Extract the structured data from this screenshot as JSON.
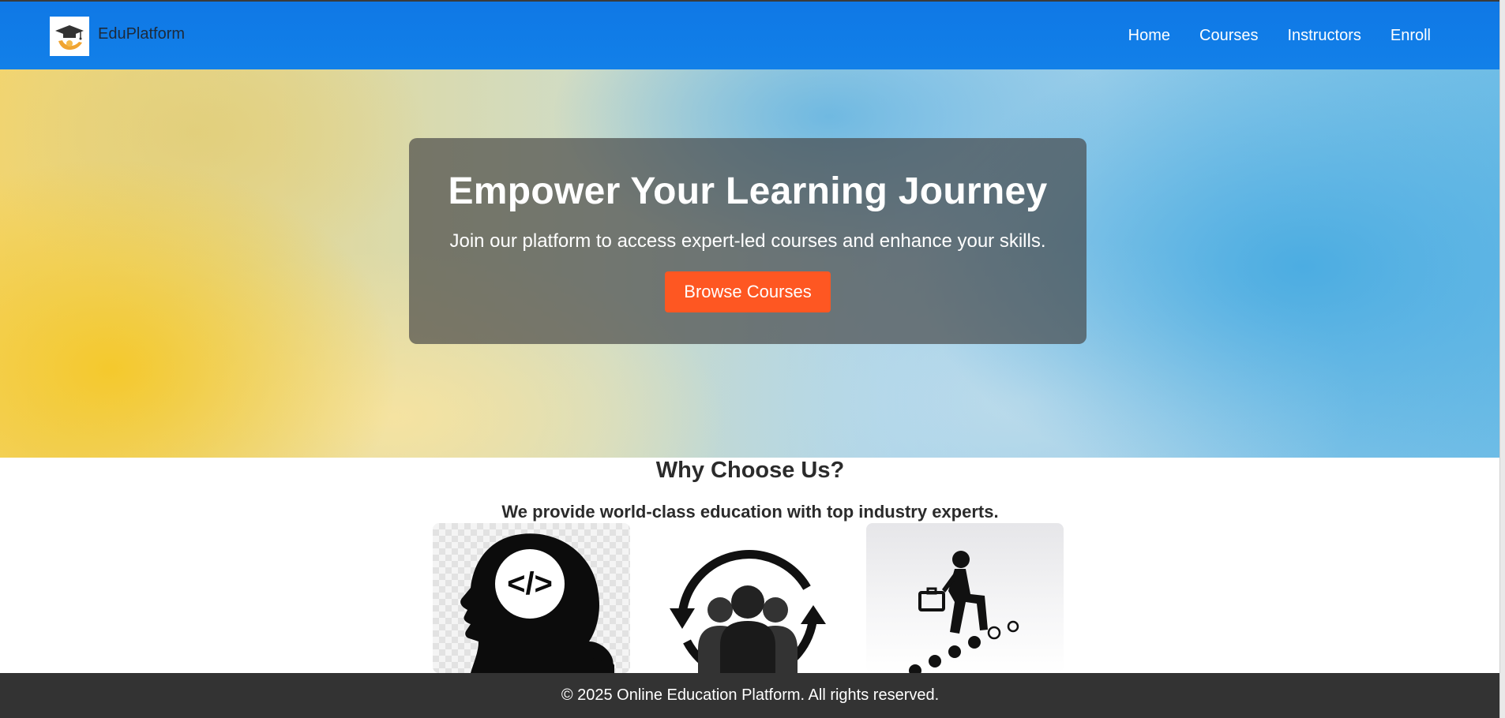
{
  "header": {
    "brand": "EduPlatform",
    "logo_icon": "graduation-cap-hand-icon",
    "nav": [
      "Home",
      "Courses",
      "Instructors",
      "Enroll"
    ]
  },
  "hero": {
    "title": "Empower Your Learning Journey",
    "subtitle": "Join our platform to access expert-led courses and enhance your skills.",
    "cta_label": "Browse Courses",
    "cta_color": "#fe5722"
  },
  "why": {
    "title": "Why Choose Us?",
    "subtitle": "We provide world-class education with top industry experts.",
    "cards": [
      {
        "icon": "head-code-icon"
      },
      {
        "icon": "team-cycle-icon"
      },
      {
        "icon": "stairs-climb-icon"
      }
    ]
  },
  "footer": {
    "text": "© 2025 Online Education Platform. All rights reserved."
  },
  "colors": {
    "header_bg": "#1280e8",
    "footer_bg": "#333333"
  }
}
